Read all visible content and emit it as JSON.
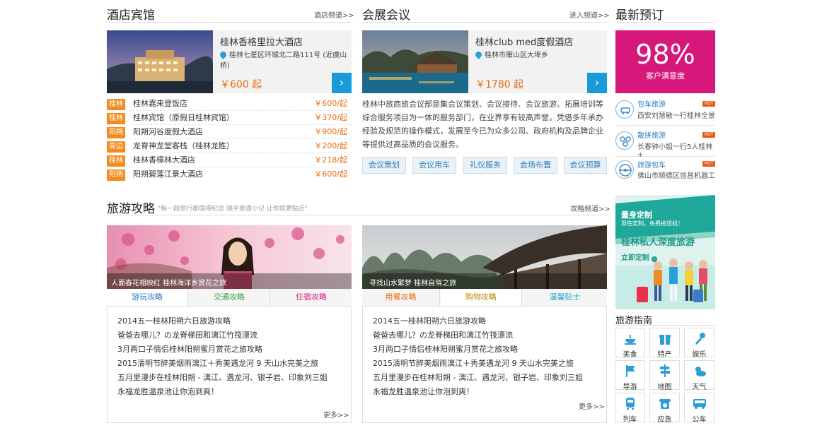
{
  "hotels": {
    "title": "酒店宾馆",
    "more": "酒店频道>",
    "featured": {
      "name": "桂林香格里拉大酒店",
      "address": "桂林七星区环城北二路111号 (近虞山桥)",
      "price": "￥600 起",
      "go": "›"
    },
    "items": [
      {
        "tag": "桂林",
        "name": "桂林嘉来登饭店",
        "price": "￥600/起"
      },
      {
        "tag": "桂林",
        "name": "桂林宾馆（原假日桂林宾馆）",
        "price": "￥370/起"
      },
      {
        "tag": "阳朔",
        "name": "阳朔河谷度假大酒店",
        "price": "￥900/起"
      },
      {
        "tag": "周边",
        "name": "龙脊神龙堂客栈（桂林龙胜）",
        "price": "￥200/起"
      },
      {
        "tag": "桂林",
        "name": "桂林香樟林大酒店",
        "price": "￥218/起"
      },
      {
        "tag": "阳朔",
        "name": "阳朔碧莲江景大酒店",
        "price": "￥600/起"
      }
    ]
  },
  "conference": {
    "title": "会展会议",
    "more": "进入频道>",
    "featured": {
      "name": "桂林club med度假酒店",
      "address": "桂林市雁山区大埠乡",
      "price": "￥1780 起",
      "go": "›"
    },
    "desc": "桂林中旅商旅会议部是集会议策划、会议接待、会议旅游、拓展培训等综合服务项目为一体的服务部门，在业界享有较高声誉。凭借多年承办经验及规范的操作模式，发展至今已为众多公司、政府机构及品牌企业等提供过高品质的会议服务。",
    "buttons": [
      "会议策划",
      "会议用车",
      "礼仪服务",
      "会场布置",
      "会议预算"
    ]
  },
  "latest": {
    "title": "最新预订",
    "stat": {
      "value": "98%",
      "label": "客户满意度"
    },
    "items": [
      {
        "title": "包车旅游",
        "sub": "西安刘慧敏一行桂林全景",
        "hot": "HOT",
        "icon": "car-icon"
      },
      {
        "title": "散拼旅游",
        "sub": "长春钟小姐一行5人桂林+",
        "hot": "HOT",
        "icon": "group-icon"
      },
      {
        "title": "旅游包车",
        "sub": "佛山市顺德区信昌机器工",
        "hot": "HOT",
        "icon": "steering-wheel-icon"
      }
    ]
  },
  "guide": {
    "title": "旅游攻略",
    "slogan": "\"每一段旅行都值得纪念  随手旅途小记  让你就更贴近\"",
    "more": "攻略频道>",
    "left": {
      "caption": "人面春花相映红 桂林海洋乡赏花之旅",
      "tabs": [
        "游玩攻略",
        "交通攻略",
        "住宿攻略"
      ],
      "list": [
        "2014五一桂林阳朔六日旅游攻略",
        "爸爸去哪儿？の龙脊梯田和漓江竹筏漂流",
        "3月两口子情侣桂林阳朔蜜月赏花之旅攻略",
        "2015清明节醉美烟雨漓江＋秀美遇龙河 9 天山水完美之旅",
        "五月里漫步在桂林阳朔 - 漓江、遇龙河、银子岩、印象刘三姐",
        "永福龙胜温泉池让你泡到爽！"
      ],
      "more": "更多>>"
    },
    "right": {
      "caption": "寻找山水繁梦 桂林自驾之旅",
      "tabs": [
        "用餐攻略",
        "购物攻略",
        "温馨贴士"
      ],
      "list": [
        "2014五一桂林阳朔六日旅游攻略",
        "爸爸去哪儿？の龙脊梯田和漓江竹筏漂流",
        "3月两口子情侣桂林阳朔蜜月赏花之旅攻略",
        "2015清明节醉美烟雨漓江＋秀美遇龙河 9 天山水完美之旅",
        "五月里漫步在桂林阳朔 - 漓江、遇龙河、银子岩、印象刘三姐",
        "永福龙胜温泉池让你泡到爽！"
      ],
      "more": "更多>>"
    }
  },
  "promo": {
    "line1": "量身定制",
    "line2": "现在定制，免费接送机！",
    "headline": "桂林私人深度旅游",
    "cta": "立即定制"
  },
  "travel_guide": {
    "title": "旅游指南",
    "items": [
      {
        "label": "美食",
        "icon": "food-icon"
      },
      {
        "label": "特产",
        "icon": "gift-icon"
      },
      {
        "label": "娱乐",
        "icon": "microphone-icon"
      },
      {
        "label": "导游",
        "icon": "flag-icon"
      },
      {
        "label": "地图",
        "icon": "signpost-icon"
      },
      {
        "label": "天气",
        "icon": "weather-icon"
      },
      {
        "label": "列车",
        "icon": "train-icon"
      },
      {
        "label": "应急",
        "icon": "phone-icon"
      },
      {
        "label": "公车",
        "icon": "bus-icon"
      }
    ]
  },
  "colors": {
    "accent_orange": "#f48b1e",
    "brand_blue": "#1a9bd9",
    "stat_pink": "#d6187a",
    "price": "#e96b10"
  }
}
